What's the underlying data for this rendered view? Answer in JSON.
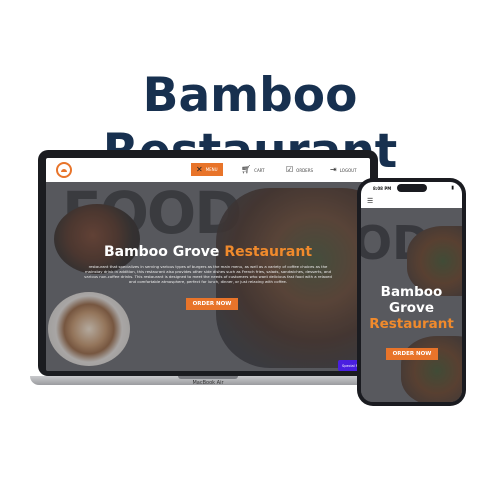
{
  "promo": {
    "title": "Bamboo Restaurant"
  },
  "laptop": {
    "model": "MacBook Air",
    "nav": {
      "items": [
        {
          "label": "MENU",
          "icon": "utensils-icon",
          "active": true
        },
        {
          "label": "CART",
          "icon": "cart-icon",
          "active": false
        },
        {
          "label": "ORDERS",
          "icon": "orders-icon",
          "active": false
        },
        {
          "label": "LOGOUT",
          "icon": "logout-icon",
          "active": false
        }
      ]
    },
    "hero": {
      "background_word": "FOOD",
      "title_main": "Bamboo Grove",
      "title_accent": "Restaurant",
      "description": "restaurant that specializes in serving various types of burgers as the main menu, as well as a variety of coffee choices as the mainstay drink in addition, this restaurant also provides other side dishes such as French fries, salads, sandwiches, desserts, and various non-coffee drinks. This restaurant is designed to meet the needs of customers who want delicious fast food with a relaxed and comfortable atmosphere, perfect for lunch, dinner, or just relaxing with coffee.",
      "order_button": "ORDER NOW",
      "special_badge": "Special Pro"
    }
  },
  "phone": {
    "status_time": "8:08 PM",
    "hero": {
      "background_word": "OD",
      "title_line1": "Bamboo",
      "title_line2": "Grove",
      "title_accent": "Restaurant",
      "order_button": "ORDER NOW"
    }
  },
  "colors": {
    "accent": "#e8742a",
    "title": "#17304f",
    "badge": "#4a1fe0"
  }
}
